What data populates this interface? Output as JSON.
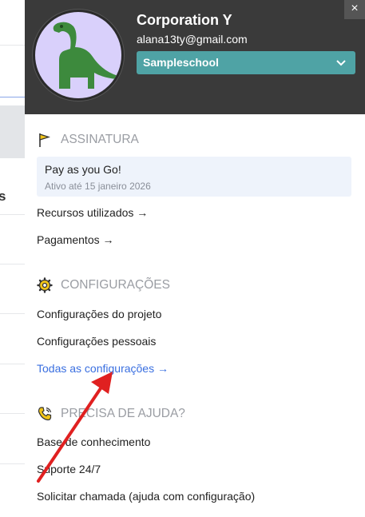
{
  "header": {
    "org_name": "Corporation Y",
    "email": "alana13ty@gmail.com",
    "workspace_select": "Sampleschool",
    "close_label": "×"
  },
  "subscription": {
    "title": "ASSINATURA",
    "plan_name": "Pay as you Go!",
    "plan_status": "Ativo até 15 janeiro 2026",
    "links": [
      "Recursos utilizados →",
      "Pagamentos →"
    ]
  },
  "settings": {
    "title": "CONFIGURAÇÕES",
    "links": [
      "Configurações do projeto",
      "Configurações pessoais",
      "Todas as configurações →"
    ]
  },
  "help": {
    "title": "PRECISA DE AJUDA?",
    "links": [
      "Base de conhecimento",
      "Suporte 24/7",
      "Solicitar chamada (ajuda com configuração)"
    ]
  },
  "background": {
    "fragment": "s"
  },
  "colors": {
    "header_bg": "#3a3a3a",
    "select_bg": "#4fa3a5",
    "avatar_bg": "#d9d0fb",
    "dino": "#3d8a3d",
    "link_blue": "#3a6fe0",
    "annotation_arrow": "#e02020"
  },
  "icons": {
    "subscription": "flag-icon",
    "settings": "gear-icon",
    "help": "phone-icon",
    "avatar": "dinosaur-icon",
    "select": "chevron-down-icon"
  }
}
